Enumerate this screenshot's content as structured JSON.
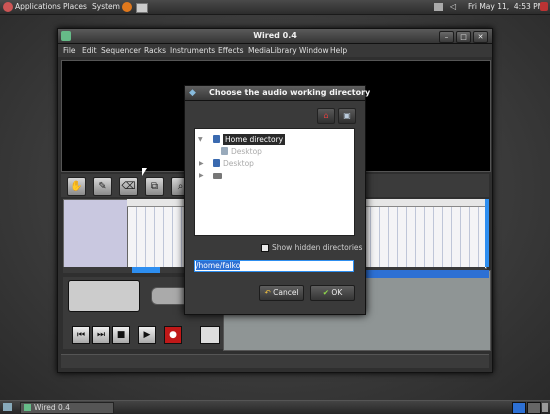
{
  "top_panel": {
    "menus": [
      "Applications",
      "Places",
      "System"
    ],
    "clock": "Fri May 11,  4:53 PM"
  },
  "main_window": {
    "title": "Wired 0.4",
    "menus": [
      "File",
      "Edit",
      "Sequencer",
      "Racks",
      "Instruments",
      "Effects",
      "MediaLibrary",
      "Window",
      "Help"
    ],
    "window_buttons": [
      "–",
      "□",
      "✕"
    ]
  },
  "dialog": {
    "title": "Choose the audio working directory",
    "tree": [
      {
        "label": "Home directory",
        "selected": true
      },
      {
        "label": "Desktop",
        "selected": false
      },
      {
        "label": "Desktop",
        "selected": false
      },
      {
        "label": "",
        "selected": false
      }
    ],
    "show_hidden_label": "Show hidden directories",
    "path_value": "/home/falko",
    "cancel_label": "Cancel",
    "ok_label": "OK"
  },
  "taskbar": {
    "task_label": "Wired 0.4"
  },
  "colors": {
    "accent": "#2d8ef0",
    "selection": "#2d70d4",
    "record": "#c01818"
  },
  "icons": {
    "dialog": "wired-app-icon",
    "home": "home-icon",
    "new_folder": "new-folder-icon"
  }
}
